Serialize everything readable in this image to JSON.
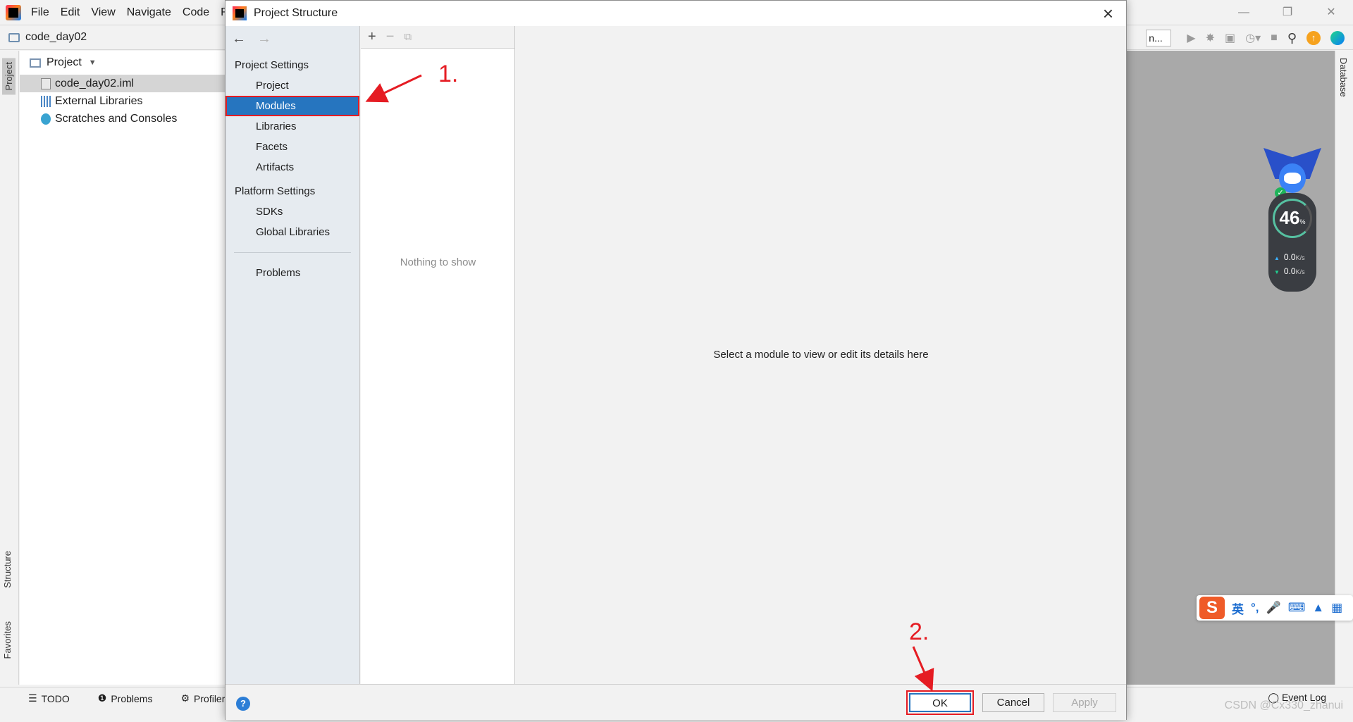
{
  "ide": {
    "menu": [
      "File",
      "Edit",
      "View",
      "Navigate",
      "Code",
      "R"
    ],
    "breadcrumb": "code_day02",
    "run_config": "n...",
    "project_panel": {
      "title": "Project",
      "items": [
        {
          "label": "code_day02.iml",
          "icon": "module-file-icon"
        },
        {
          "label": "External Libraries",
          "icon": "libraries-icon"
        },
        {
          "label": "Scratches and Consoles",
          "icon": "scratches-icon"
        }
      ]
    },
    "left_tabs": {
      "project": "Project",
      "structure": "Structure",
      "favorites": "Favorites"
    },
    "right_tabs": {
      "database": "Database"
    },
    "bottom_tabs": {
      "todo": "TODO",
      "problems": "Problems",
      "profiler": "Profiler"
    },
    "event_log": "Event Log"
  },
  "dialog": {
    "title": "Project Structure",
    "nav": {
      "project_settings_header": "Project Settings",
      "project_settings": [
        "Project",
        "Modules",
        "Libraries",
        "Facets",
        "Artifacts"
      ],
      "platform_settings_header": "Platform Settings",
      "platform_settings": [
        "SDKs",
        "Global Libraries"
      ],
      "problems": "Problems",
      "selected": "Modules"
    },
    "module_list_empty": "Nothing to show",
    "detail_placeholder": "Select a module to view or edit its details here",
    "buttons": {
      "ok": "OK",
      "cancel": "Cancel",
      "apply": "Apply",
      "help": "?"
    }
  },
  "annotations": {
    "step1": "1.",
    "step2": "2.",
    "color": "#e51c23"
  },
  "net_monitor": {
    "percent": "46",
    "percent_unit": "%",
    "upload": "0.0",
    "download": "0.0",
    "unit": "K/s"
  },
  "ime": {
    "logo": "S",
    "mode": "英"
  },
  "watermark": "CSDN @Cx330_zhanui",
  "colors": {
    "selection": "#2675bf",
    "annotation_red": "#e51c23",
    "nav_bg": "#e6ebf0"
  }
}
